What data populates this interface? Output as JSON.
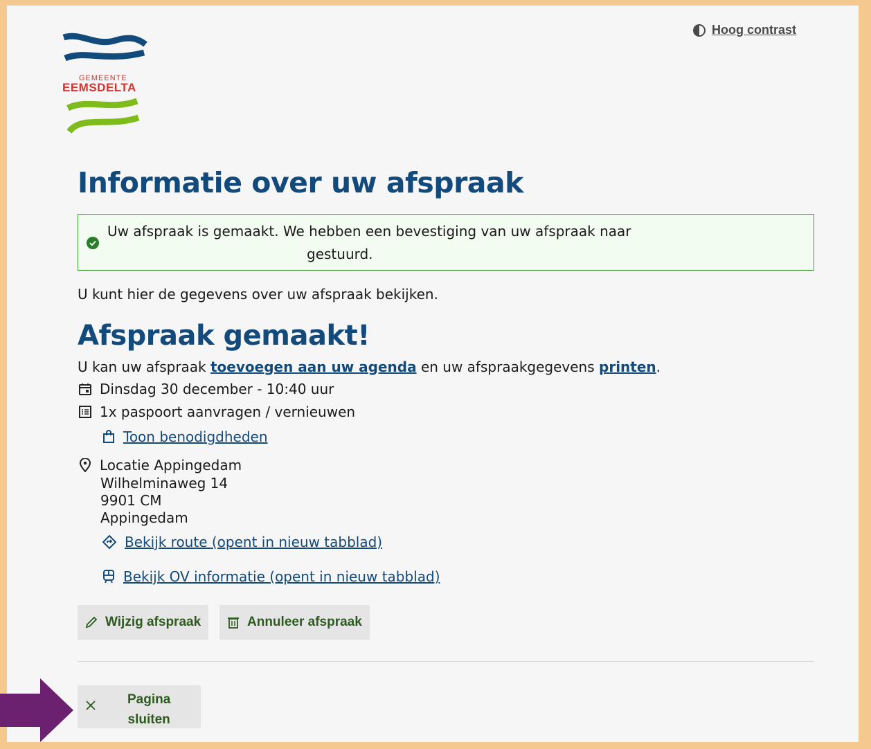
{
  "header": {
    "contrast_label": "Hoog contrast",
    "logo": {
      "line1": "GEMEENTE",
      "line2": "EEMSDELTA"
    }
  },
  "main": {
    "title": "Informatie over uw afspraak",
    "alert": {
      "line1": "Uw afspraak is gemaakt. We hebben een bevestiging van uw afspraak naar",
      "line2": "gestuurd."
    },
    "intro": "U kunt hier de gegevens over uw afspraak bekijken.",
    "subtitle": "Afspraak gemaakt!",
    "add_line": {
      "pre": "U kan uw afspraak ",
      "agenda_link": "toevoegen aan uw agenda",
      "mid": " en uw afspraakgegevens ",
      "print_link": "printen",
      "post": "."
    },
    "date": "Dinsdag 30 december - 10:40 uur",
    "product": "1x paspoort aanvragen / vernieuwen",
    "requirements_link": "Toon benodigdheden",
    "location": {
      "name": "Locatie Appingedam",
      "street": "Wilhelminaweg 14",
      "postcode": "9901 CM",
      "city": "Appingedam"
    },
    "route_link": "Bekijk route (opent in nieuw tabblad)",
    "ov_link": "Bekijk OV informatie (opent in nieuw tabblad)",
    "buttons": {
      "edit": "Wijzig afspraak",
      "cancel": "Annuleer afspraak"
    },
    "close_button": {
      "line1": "Pagina",
      "line2": "sluiten"
    }
  },
  "colors": {
    "heading": "#134a7c",
    "success": "#3f9c35",
    "frame": "#f5c88f",
    "arrow": "#6b2070"
  }
}
